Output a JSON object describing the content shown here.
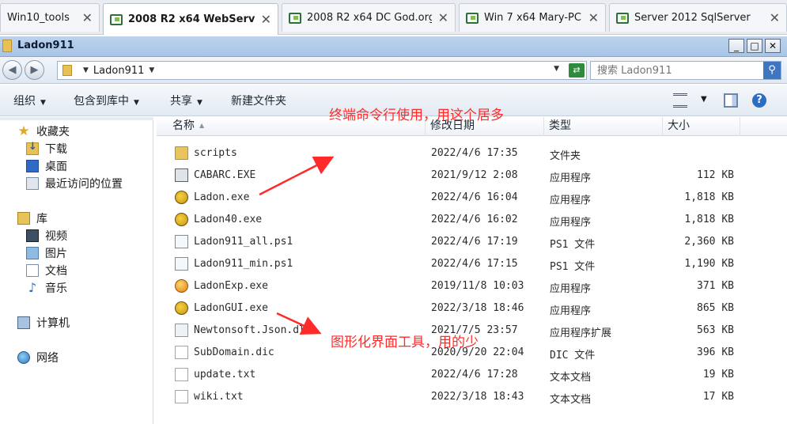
{
  "vm_tabs": [
    {
      "label": "Win10_tools",
      "active": false
    },
    {
      "label": "2008 R2 x64 WebServer",
      "active": true
    },
    {
      "label": "2008 R2 x64 DC God.org",
      "active": false
    },
    {
      "label": "Win 7 x64 Mary-PC",
      "active": false
    },
    {
      "label": "Server 2012 SqlServer",
      "active": false
    }
  ],
  "window": {
    "title": "Ladon911",
    "buttons": {
      "minimize": "_",
      "maximize": "□",
      "close": "✕"
    }
  },
  "address_bar": {
    "path": "Ladon911",
    "search_placeholder": "搜索 Ladon911"
  },
  "command_bar": {
    "organize": "组织",
    "include_in_library": "包含到库中",
    "share": "共享",
    "new_folder": "新建文件夹",
    "help_glyph": "?"
  },
  "nav_pane": {
    "favorites": {
      "label": "收藏夹",
      "items": [
        "下载",
        "桌面",
        "最近访问的位置"
      ]
    },
    "libraries": {
      "label": "库",
      "items": [
        "视频",
        "图片",
        "文档",
        "音乐"
      ]
    },
    "computer": "计算机",
    "network": "网络"
  },
  "columns": {
    "name": "名称",
    "modified": "修改日期",
    "type": "类型",
    "size": "大小"
  },
  "files": [
    {
      "name": "scripts",
      "modified": "2022/4/6 17:35",
      "type": "文件夹",
      "size": "",
      "icon": "folder"
    },
    {
      "name": "CABARC.EXE",
      "modified": "2021/9/12 2:08",
      "type": "应用程序",
      "size": "112 KB",
      "icon": "exe"
    },
    {
      "name": "Ladon.exe",
      "modified": "2022/4/6 16:04",
      "type": "应用程序",
      "size": "1,818 KB",
      "icon": "ladon"
    },
    {
      "name": "Ladon40.exe",
      "modified": "2022/4/6 16:02",
      "type": "应用程序",
      "size": "1,818 KB",
      "icon": "ladon"
    },
    {
      "name": "Ladon911_all.ps1",
      "modified": "2022/4/6 17:19",
      "type": "PS1 文件",
      "size": "2,360 KB",
      "icon": "script"
    },
    {
      "name": "Ladon911_min.ps1",
      "modified": "2022/4/6 17:15",
      "type": "PS1 文件",
      "size": "1,190 KB",
      "icon": "script"
    },
    {
      "name": "LadonExp.exe",
      "modified": "2019/11/8 10:03",
      "type": "应用程序",
      "size": "371 KB",
      "icon": "ladonexp"
    },
    {
      "name": "LadonGUI.exe",
      "modified": "2022/3/18 18:46",
      "type": "应用程序",
      "size": "865 KB",
      "icon": "ladon"
    },
    {
      "name": "Newtonsoft.Json.dll",
      "modified": "2021/7/5 23:57",
      "type": "应用程序扩展",
      "size": "563 KB",
      "icon": "dll"
    },
    {
      "name": "SubDomain.dic",
      "modified": "2020/9/20 22:04",
      "type": "DIC 文件",
      "size": "396 KB",
      "icon": "text"
    },
    {
      "name": "update.txt",
      "modified": "2022/4/6 17:28",
      "type": "文本文档",
      "size": "19 KB",
      "icon": "text"
    },
    {
      "name": "wiki.txt",
      "modified": "2022/3/18 18:43",
      "type": "文本文档",
      "size": "17 KB",
      "icon": "text"
    }
  ],
  "annotations": {
    "cli": "终端命令行使用，用这个居多",
    "gui": "图形化界面工具，用的少",
    "color": "#ff2a2a"
  }
}
